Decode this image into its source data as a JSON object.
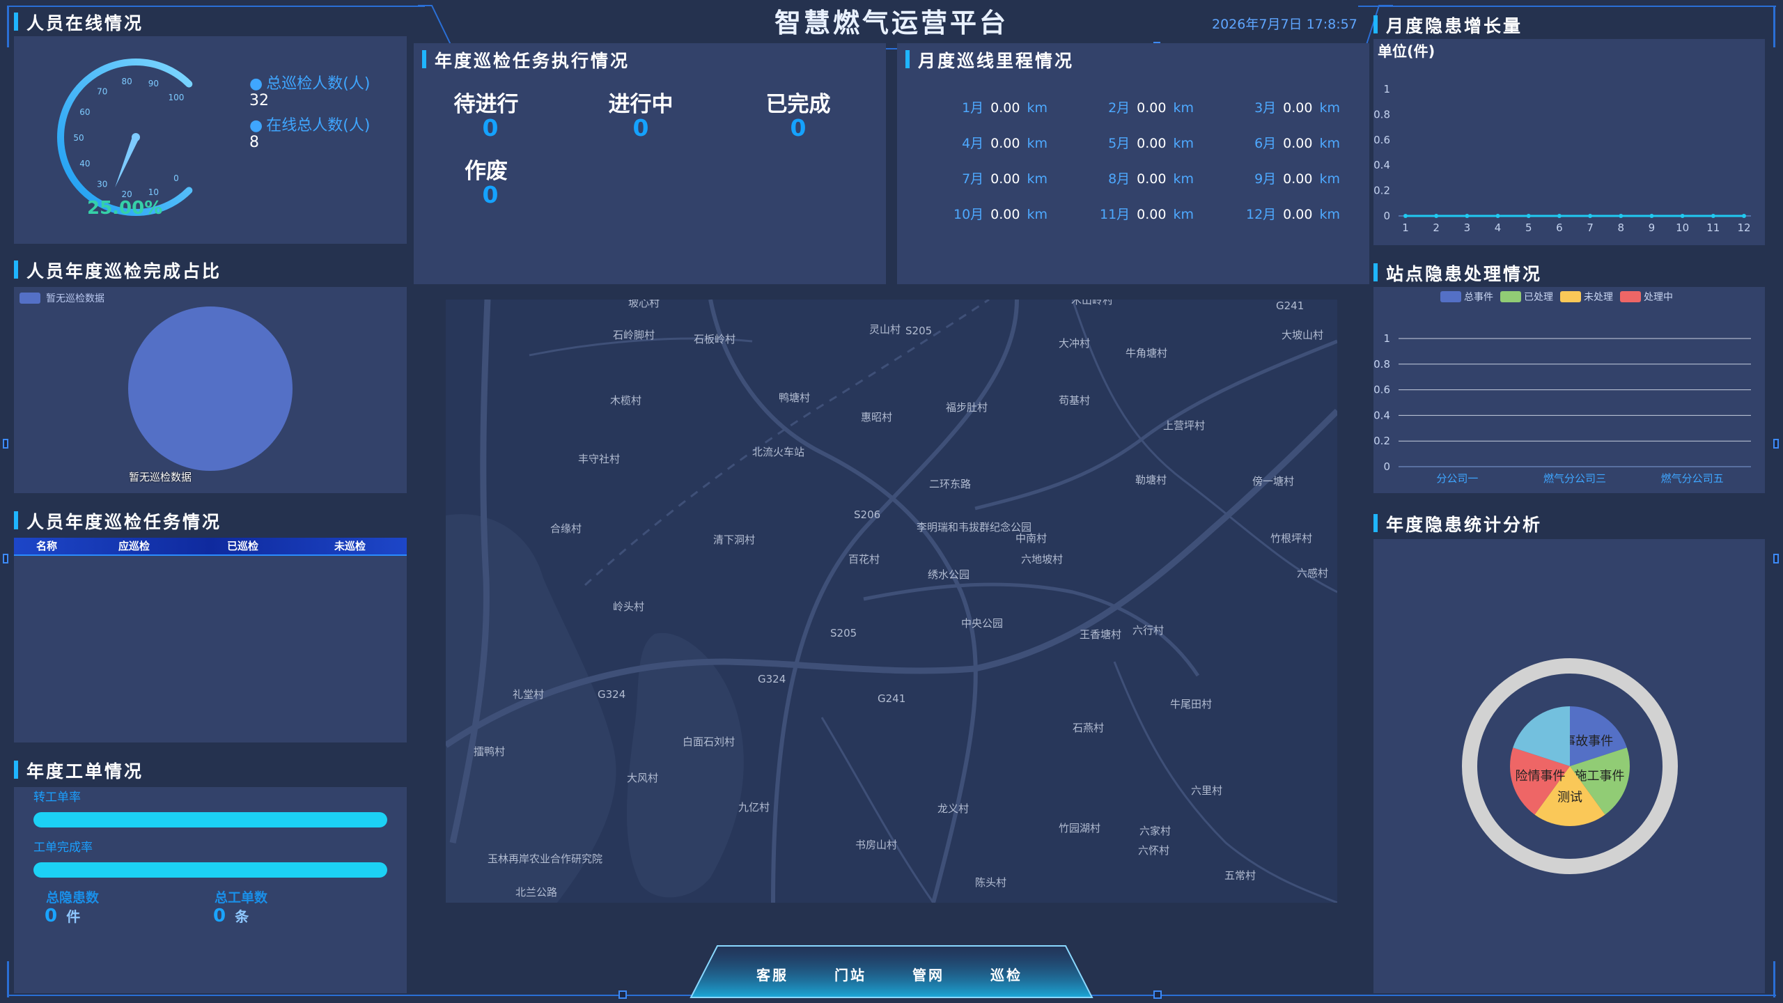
{
  "header": {
    "title": "智慧燃气运营平台",
    "datetime": "2026年7月7日 17:8:57"
  },
  "online": {
    "title": "人员在线情况",
    "gauge_ticks": [
      "0",
      "10",
      "20",
      "30",
      "40",
      "50",
      "60",
      "70",
      "80",
      "90",
      "100"
    ],
    "gauge_value_text": "25.00%",
    "gauge_value": 25,
    "legend1_label": "总巡检人数(人)",
    "legend1_value": "32",
    "legend2_label": "在线总人数(人)",
    "legend2_value": "8"
  },
  "task_exec": {
    "title": "年度巡检任务执行情况",
    "items": [
      {
        "label": "待进行",
        "value": "0"
      },
      {
        "label": "进行中",
        "value": "0"
      },
      {
        "label": "已完成",
        "value": "0"
      },
      {
        "label": "作废",
        "value": "0"
      }
    ]
  },
  "mileage": {
    "title": "月度巡线里程情况",
    "months": [
      {
        "m": "1月",
        "v": "0.00",
        "u": "km"
      },
      {
        "m": "2月",
        "v": "0.00",
        "u": "km"
      },
      {
        "m": "3月",
        "v": "0.00",
        "u": "km"
      },
      {
        "m": "4月",
        "v": "0.00",
        "u": "km"
      },
      {
        "m": "5月",
        "v": "0.00",
        "u": "km"
      },
      {
        "m": "6月",
        "v": "0.00",
        "u": "km"
      },
      {
        "m": "7月",
        "v": "0.00",
        "u": "km"
      },
      {
        "m": "8月",
        "v": "0.00",
        "u": "km"
      },
      {
        "m": "9月",
        "v": "0.00",
        "u": "km"
      },
      {
        "m": "10月",
        "v": "0.00",
        "u": "km"
      },
      {
        "m": "11月",
        "v": "0.00",
        "u": "km"
      },
      {
        "m": "12月",
        "v": "0.00",
        "u": "km"
      }
    ]
  },
  "completion_ratio": {
    "title": "人员年度巡检完成占比",
    "legend": "暂无巡检数据",
    "slice_label": "暂无巡检数据"
  },
  "annual_tasks": {
    "title": "人员年度巡检任务情况",
    "columns": [
      "名称",
      "应巡检",
      "已巡检",
      "未巡检"
    ]
  },
  "work_orders": {
    "title": "年度工单情况",
    "transfer_label": "转工单率",
    "transfer_rate": 1.0,
    "complete_label": "工单完成率",
    "complete_rate": 1.0,
    "hazard_label": "总隐患数",
    "hazard_value": "0",
    "hazard_unit": "件",
    "orders_label": "总工单数",
    "orders_value": "0",
    "orders_unit": "条"
  },
  "map": {
    "labels": [
      "坡心村",
      "石岭脚村",
      "石板岭村",
      "灵山村",
      "S205",
      "木山岭村",
      "大冲村",
      "牛角塘村",
      "G241",
      "大坡山村",
      "木榄村",
      "鸭塘村",
      "福步肚村",
      "苟基村",
      "惠昭村",
      "北流火车站",
      "上营坪村",
      "丰守社村",
      "二环东路",
      "勒塘村",
      "傍一塘村",
      "S206",
      "李明瑞和韦拔群纪念公园",
      "合缘村",
      "清下洞村",
      "中南村",
      "竹根坪村",
      "百花村",
      "六地坡村",
      "绣水公园",
      "六感村",
      "岭头村",
      "中央公园",
      "S205",
      "王香塘村",
      "六行村",
      "礼堂村",
      "G324",
      "G324",
      "G241",
      "白面石刘村",
      "牛尾田村",
      "石燕村",
      "擂鸭村",
      "大风村",
      "九亿村",
      "龙义村",
      "六里村",
      "竹园湖村",
      "六家村",
      "书房山村",
      "六怀村",
      "五常村",
      "玉林再岸农业合作研究院",
      "陈头村",
      "北兰公路"
    ]
  },
  "tabs": [
    "客服",
    "门站",
    "管网",
    "巡检"
  ],
  "monthly_growth": {
    "title": "月度隐患增长量",
    "unit_label": "单位(件)"
  },
  "station_hazard": {
    "title": "站点隐患处理情况",
    "legend": [
      {
        "name": "总事件",
        "color": "#5470c6"
      },
      {
        "name": "已处理",
        "color": "#91cc75"
      },
      {
        "name": "未处理",
        "color": "#fac858"
      },
      {
        "name": "处理中",
        "color": "#ee6666"
      }
    ]
  },
  "annual_hazard": {
    "title": "年度隐患统计分析",
    "slices": [
      {
        "name": "事故事件",
        "value": 1,
        "color": "#5470c6"
      },
      {
        "name": "施工事件",
        "value": 1,
        "color": "#91cc75"
      },
      {
        "name": "测试",
        "value": 1,
        "color": "#fac858"
      },
      {
        "name": "险情事件",
        "value": 1,
        "color": "#ee6666"
      },
      {
        "name": "",
        "value": 1,
        "color": "#73c0de"
      }
    ]
  },
  "chart_data": [
    {
      "type": "line",
      "title": "月度隐患增长量",
      "ylabel": "单位(件)",
      "x": [
        1,
        2,
        3,
        4,
        5,
        6,
        7,
        8,
        9,
        10,
        11,
        12
      ],
      "series": [
        {
          "values": [
            0,
            0,
            0,
            0,
            0,
            0,
            0,
            0,
            0,
            0,
            0,
            0
          ]
        }
      ],
      "y_ticks": [
        "0",
        "0.2",
        "0.4",
        "0.6",
        "0.8",
        "1"
      ],
      "ylim": [
        0,
        1
      ]
    },
    {
      "type": "bar",
      "title": "站点隐患处理情况",
      "categories": [
        "分公司一",
        "燃气分公司三",
        "燃气分公司五"
      ],
      "series": [
        {
          "name": "总事件",
          "values": [
            0,
            0,
            0
          ]
        },
        {
          "name": "已处理",
          "values": [
            0,
            0,
            0
          ]
        },
        {
          "name": "未处理",
          "values": [
            0,
            0,
            0
          ]
        },
        {
          "name": "处理中",
          "values": [
            0,
            0,
            0
          ]
        }
      ],
      "y_ticks": [
        "0",
        "0.2",
        "0.4",
        "0.6",
        "0.8",
        "1"
      ],
      "ylim": [
        0,
        1
      ]
    }
  ]
}
